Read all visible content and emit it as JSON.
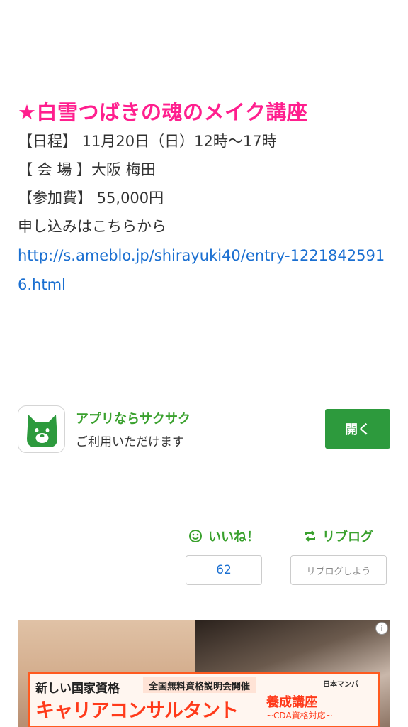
{
  "article": {
    "title": "★白雪つばきの魂のメイク講座",
    "lines": [
      "【日程】 11月20日（日）12時〜17時",
      "【 会 場 】大阪 梅田",
      "【参加費】  55,000円",
      "申し込みはこちらから"
    ],
    "link": "http://s.ameblo.jp/shirayuki40/entry-12218425916.html"
  },
  "app_banner": {
    "title": "アプリならサクサク",
    "subtitle": "ご利用いただけます",
    "button": "開く",
    "icon": "ameba-dog-icon",
    "colors": {
      "green": "#2d9a3d",
      "text_green": "#3aa12e"
    }
  },
  "actions": {
    "like_label": "いいね！",
    "like_count": "62",
    "reblog_label": "リブログ",
    "reblog_placeholder": "リブログしよう"
  },
  "ad": {
    "line1": "新しい国家資格",
    "pill": "全国無料資格説明会開催",
    "line2": "キャリアコンサルタント",
    "line3": "養成講座",
    "line4": "~CDA資格対応~",
    "logo": "日本マンパ",
    "info": "i"
  },
  "colors": {
    "title": "#ff1f8e",
    "link": "#1a6fd1"
  }
}
